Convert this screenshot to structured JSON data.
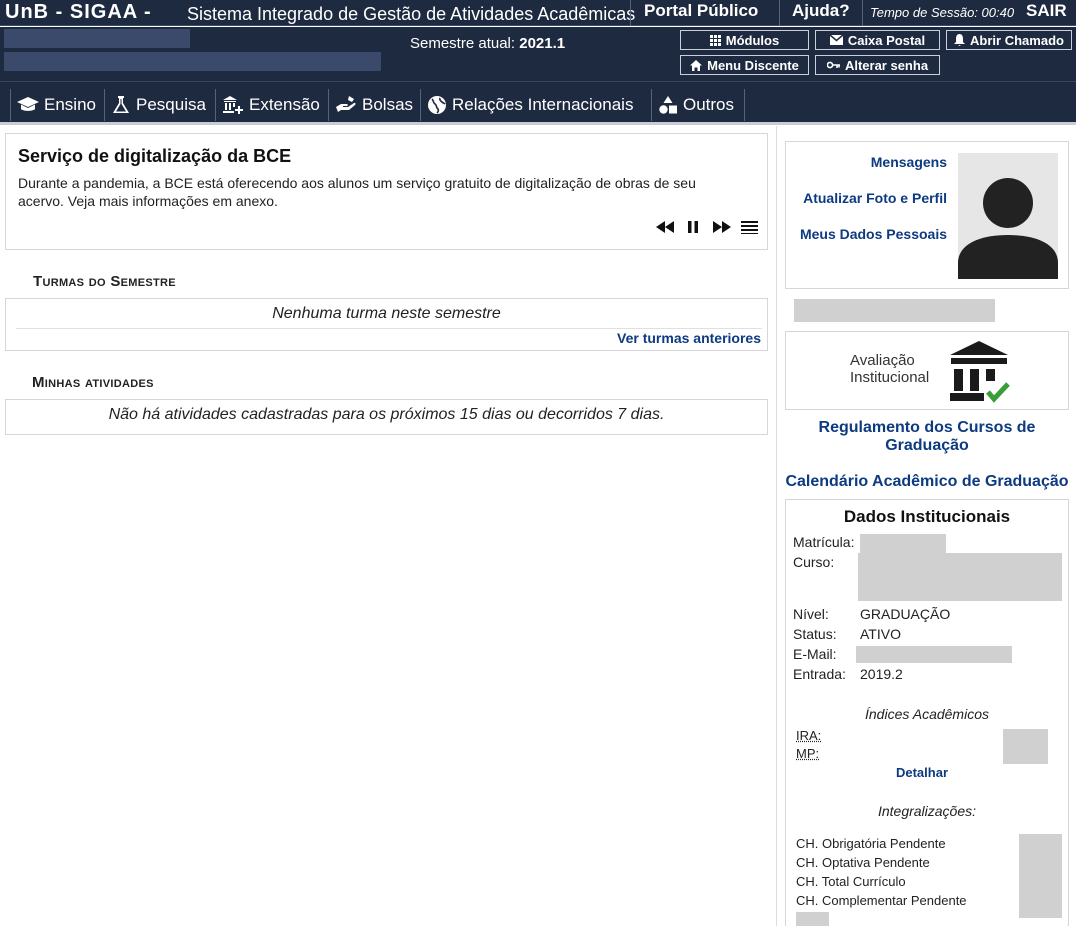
{
  "header": {
    "brand": "UnB - SIGAA -",
    "system_name": "Sistema Integrado de Gestão de Atividades Acadêmicas",
    "portal_link": "Portal Público",
    "help_link": "Ajuda?",
    "session_label": "Tempo de Sessão: 00:40",
    "logout": "SAIR"
  },
  "infobar": {
    "semester_label": "Semestre atual:",
    "semester_value": "2021.1",
    "buttons": {
      "modulos": "Módulos",
      "caixa_postal": "Caixa Postal",
      "abrir_chamado": "Abrir Chamado",
      "menu_discente": "Menu Discente",
      "alterar_senha": "Alterar senha"
    }
  },
  "menu": {
    "items": [
      "Ensino",
      "Pesquisa",
      "Extensão",
      "Bolsas",
      "Relações Internacionais",
      "Outros"
    ]
  },
  "news": {
    "title": "Serviço de digitalização da BCE",
    "body": "Durante a pandemia, a BCE está oferecendo aos alunos um serviço gratuito de digitalização de obras de seu acervo. Veja mais informações em anexo."
  },
  "turmas": {
    "title": "Turmas do Semestre",
    "empty": "Nenhuma turma neste semestre",
    "link": "Ver turmas anteriores"
  },
  "atividades": {
    "title": "Minhas atividades",
    "empty": "Não há atividades cadastradas para os próximos 15 dias ou decorridos 7 dias."
  },
  "profile": {
    "links": [
      "Mensagens",
      "Atualizar Foto e Perfil",
      "Meus Dados Pessoais"
    ]
  },
  "avaliacao": {
    "line1": "Avaliação",
    "line2": "Institucional"
  },
  "regulamento": {
    "line1": "Regulamento dos Cursos de",
    "line2": "Graduação"
  },
  "calendario": "Calendário Acadêmico de Graduação",
  "dados": {
    "title": "Dados Institucionais",
    "labels": {
      "matricula": "Matrícula:",
      "curso": "Curso:",
      "nivel": "Nível:",
      "status": "Status:",
      "email": "E-Mail:",
      "entrada": "Entrada:"
    },
    "values": {
      "nivel": "GRADUAÇÃO",
      "status": "ATIVO",
      "entrada": "2019.2"
    },
    "indices_title": "Índices Acadêmicos",
    "ira": "IRA:",
    "mp": "MP:",
    "detalhar": "Detalhar",
    "integralizacoes_title": "Integralizações:",
    "integralizacoes": [
      "CH. Obrigatória Pendente",
      "CH. Optativa Pendente",
      "CH. Total Currículo",
      "CH. Complementar Pendente"
    ]
  },
  "colors": {
    "header_bg": "#1e2a40",
    "link": "#0d3a80",
    "redacted": "#d0d0d0"
  }
}
